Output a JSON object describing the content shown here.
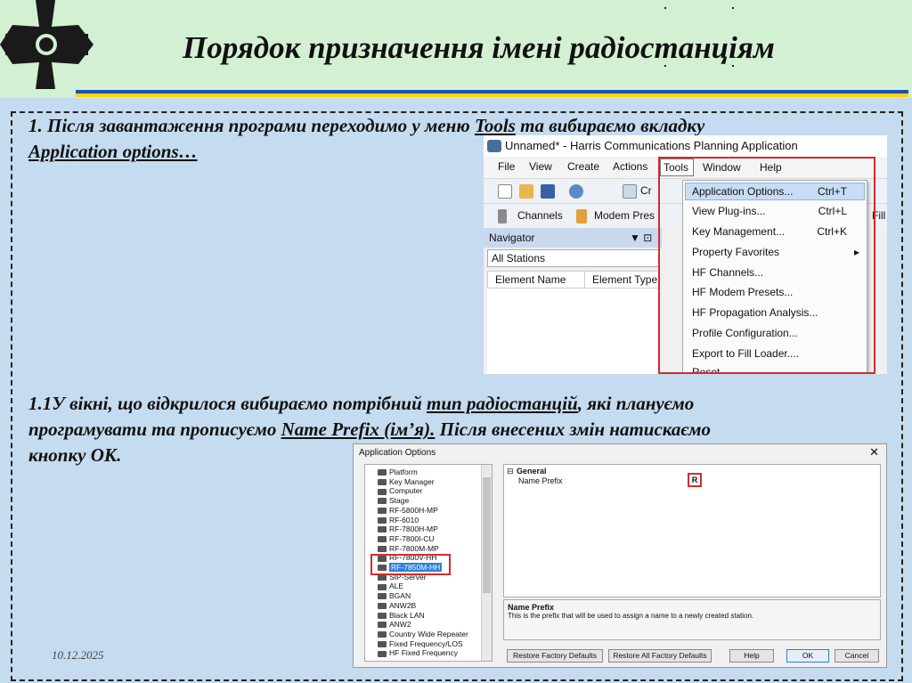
{
  "header": {
    "title": "Порядок призначення імені радіостанціям"
  },
  "steps": {
    "step1_prefix": "1. Після завантаження програми переходимо у меню ",
    "step1_tools": "Tools",
    "step1_mid": " та вибираємо вкладку",
    "step1_app_options": "Application options…",
    "step2_line1_a": "1.1У вікні, що відкрилося вибираємо потрібний ",
    "step2_type": "тип радіостанцій",
    "step2_line1_b": ", які плануємо",
    "step2_line2_a": "програмувати та прописуємо ",
    "step2_name_prefix": "Name Prefix (ім’я).",
    "step2_line2_b": " Після внесених змін натискаємо",
    "step2_line3": "кнопку ОК."
  },
  "screenshot1": {
    "window_title": "Unnamed* - Harris Communications Planning Application",
    "menu": [
      "File",
      "View",
      "Create",
      "Actions",
      "Tools",
      "Window",
      "Help"
    ],
    "toolbar2": [
      "Channels",
      "Modem Pres",
      "Fill"
    ],
    "toolbar1_cut": "Cr",
    "navigator_label": "Navigator",
    "navigator_icons": "▼ ⊡",
    "all_stations": "All Stations",
    "col_element_name": "Element Name",
    "col_element_type": "Element Type",
    "tools_menu": [
      {
        "label": "Application Options...",
        "shortcut": "Ctrl+T"
      },
      {
        "label": "View Plug-ins...",
        "shortcut": "Ctrl+L"
      },
      {
        "label": "Key Management...",
        "shortcut": "Ctrl+K"
      },
      {
        "label": "Property Favorites",
        "shortcut": "▸"
      },
      {
        "label": "HF Channels...",
        "shortcut": ""
      },
      {
        "label": "HF Modem Presets...",
        "shortcut": ""
      },
      {
        "label": "HF Propagation Analysis...",
        "shortcut": ""
      },
      {
        "label": "Profile Configuration...",
        "shortcut": ""
      },
      {
        "label": "Export to Fill Loader....",
        "shortcut": ""
      },
      {
        "label": "Reset ...",
        "shortcut": ""
      }
    ]
  },
  "screenshot2": {
    "window_title": "Application Options",
    "close_glyph": "✕",
    "tree": [
      "Platform",
      "Key Manager",
      "Computer",
      "Stage",
      "RF-5800H-MP",
      "RF-6010",
      "RF-7800H-MP",
      "RF-7800I-CU",
      "RF-7800M-MP",
      "RF-7800V-HH",
      "RF-7850M-HH",
      "SIP-Server",
      "ALE",
      "BGAN",
      "ANW2B",
      "Black LAN",
      "ANW2",
      "Country Wide Repeater",
      "Fixed Frequency/LOS",
      "HF Fixed Frequency"
    ],
    "tree_selected_index": 10,
    "grid_section": "General",
    "grid_collapse": "⊟",
    "grid_property": "Name Prefix",
    "grid_value": "R",
    "desc_title": "Name Prefix",
    "desc_text": "This is the prefix that will be used to assign a name to a newly created station.",
    "buttons": {
      "restore_factory": "Restore Factory Defaults",
      "restore_all": "Restore All Factory Defaults",
      "help": "Help",
      "ok": "OK",
      "cancel": "Cancel"
    }
  },
  "footer": {
    "date": "10.12.2025"
  },
  "colors": {
    "header_bg": "#d3f0d3",
    "page_bg": "#c5dbef",
    "stripe_blue": "#1d4fb8",
    "stripe_yellow": "#ffd500",
    "highlight_red": "#d42b2b"
  }
}
